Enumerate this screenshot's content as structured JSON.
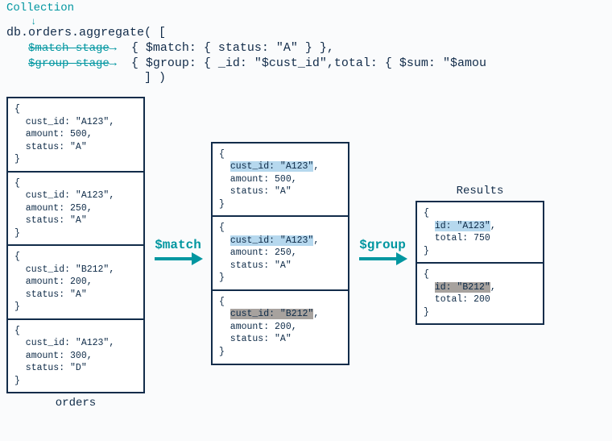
{
  "header": {
    "collection_label": "Collection",
    "code_prefix": "db.orders.aggregate( [",
    "match_stage_label": "$match stage",
    "group_stage_label": "$group stage",
    "match_code": "{ $match: { status: \"A\" } },",
    "group_code": "{ $group: { _id: \"$cust_id\",total: { $sum: \"$amou",
    "closing": "] )"
  },
  "columns": {
    "orders_label": "orders",
    "results_label": "Results",
    "match_op": "$match",
    "group_op": "$group"
  },
  "orders_docs": [
    {
      "cust_id": "A123",
      "amount": 500,
      "status": "A"
    },
    {
      "cust_id": "A123",
      "amount": 250,
      "status": "A"
    },
    {
      "cust_id": "B212",
      "amount": 200,
      "status": "A"
    },
    {
      "cust_id": "A123",
      "amount": 300,
      "status": "D"
    }
  ],
  "matched_docs": [
    {
      "cust_id": "A123",
      "amount": 500,
      "status": "A",
      "hl": "blue"
    },
    {
      "cust_id": "A123",
      "amount": 250,
      "status": "A",
      "hl": "blue"
    },
    {
      "cust_id": "B212",
      "amount": 200,
      "status": "A",
      "hl": "gray"
    }
  ],
  "results_docs": [
    {
      "id": "A123",
      "total": 750,
      "hl": "blue"
    },
    {
      "id": "B212",
      "total": 200,
      "hl": "gray"
    }
  ]
}
